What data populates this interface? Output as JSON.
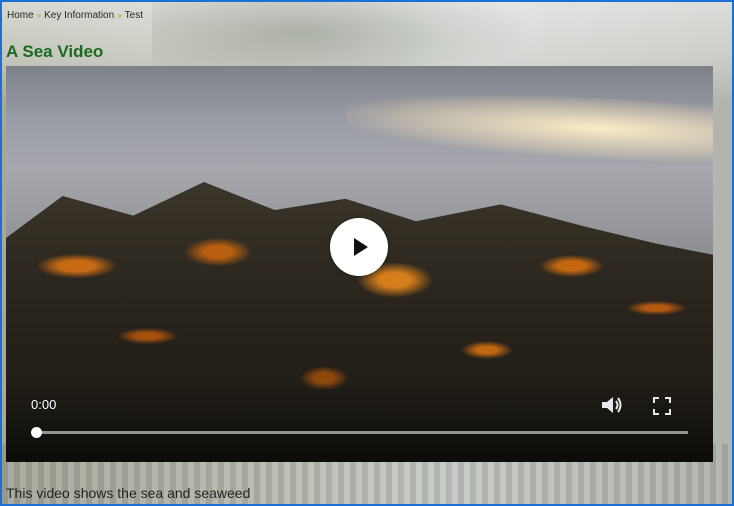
{
  "breadcrumb": {
    "items": [
      "Home",
      "Key Information",
      "Test"
    ],
    "separator": "»"
  },
  "page": {
    "title": "A Sea Video",
    "caption": "This video shows the sea and seaweed"
  },
  "video_player": {
    "current_time": "0:00",
    "progress_fraction": 0,
    "play_icon": "play-icon",
    "volume_icon": "volume-icon",
    "fullscreen_icon": "fullscreen-icon"
  },
  "colors": {
    "title": "#1a6b1f",
    "frame_border": "#1b6fd6",
    "breadcrumb_separator": "#8ab33a"
  }
}
